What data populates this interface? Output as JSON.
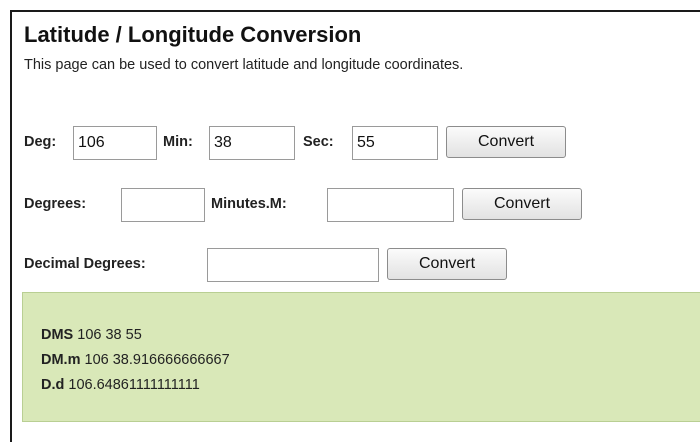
{
  "title": "Latitude / Longitude Conversion",
  "subtitle": "This page can be used to convert latitude and longitude coordinates.",
  "dms_form": {
    "deg_label": "Deg:",
    "deg_value": "106",
    "min_label": "Min:",
    "min_value": "38",
    "sec_label": "Sec:",
    "sec_value": "55",
    "button": "Convert"
  },
  "dm_form": {
    "degrees_label": "Degrees:",
    "degrees_value": "",
    "minutes_label": "Minutes.M:",
    "minutes_value": "",
    "button": "Convert"
  },
  "dd_form": {
    "decimal_label": "Decimal Degrees:",
    "decimal_value": "",
    "button": "Convert"
  },
  "results": {
    "dms_label": "DMS",
    "dms_value": "106 38 55",
    "dmm_label": "DM.m",
    "dmm_value": "106 38.916666666667",
    "dd_label": "D.d",
    "dd_value": "106.64861111111111"
  },
  "colors": {
    "result_background": "#d9e8b8",
    "result_border": "#b9cf93"
  }
}
